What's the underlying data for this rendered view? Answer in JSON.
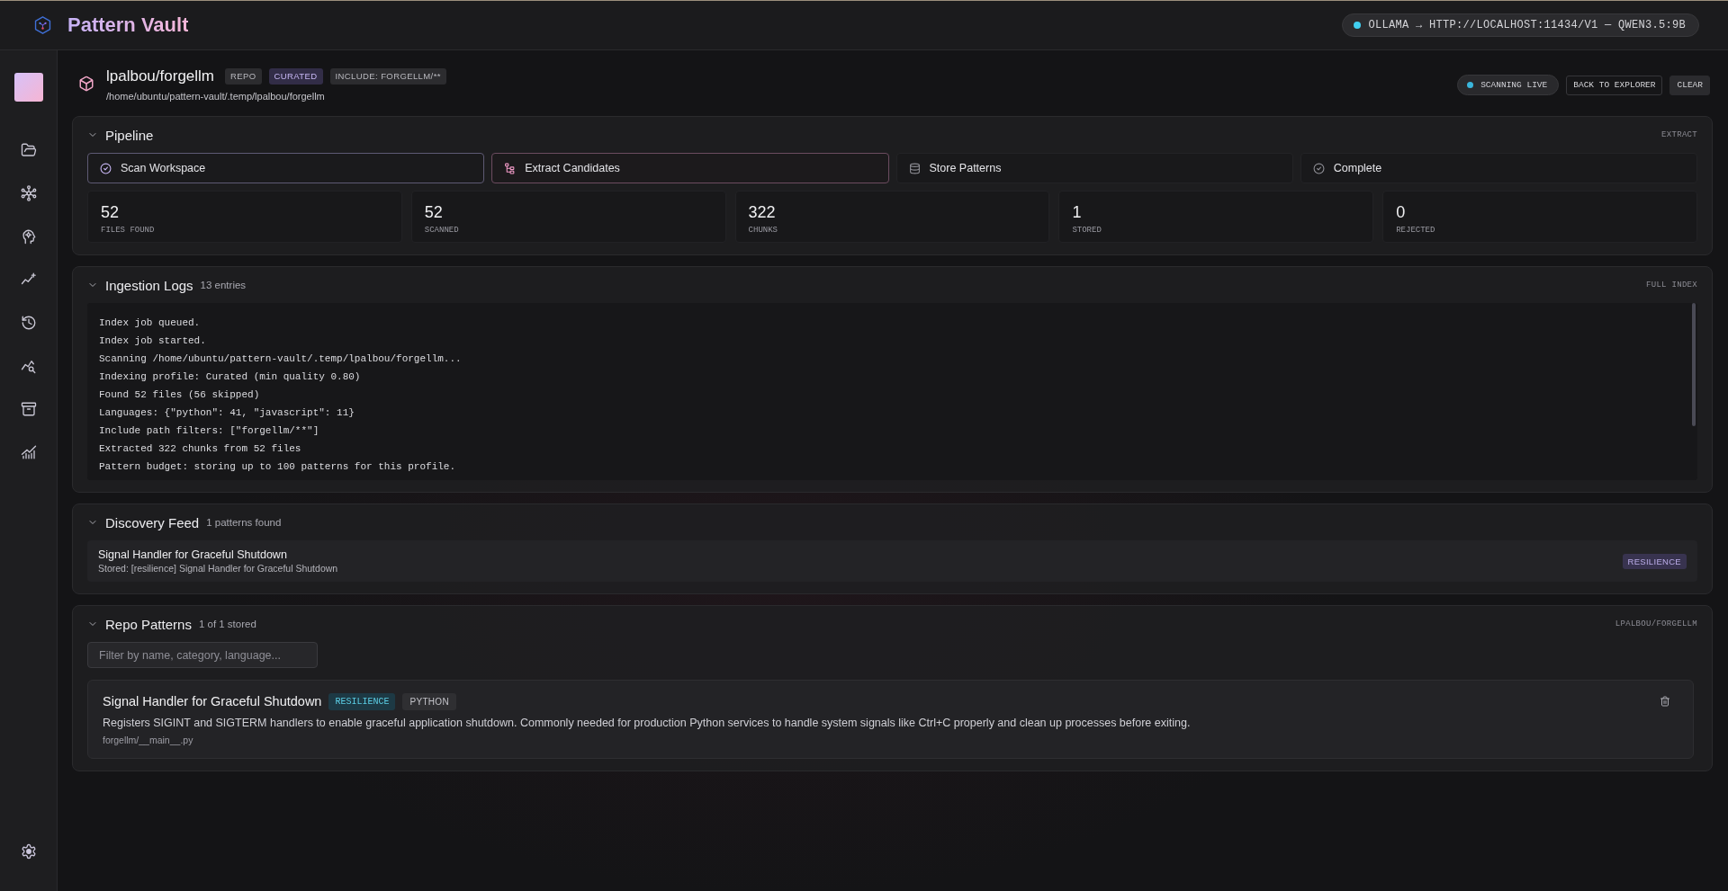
{
  "app": {
    "title": "Pattern Vault",
    "endpoint": {
      "label": "OLLAMA → HTTP://LOCALHOST:11434/V1 — QWEN3.5:9B",
      "connected": true
    }
  },
  "repo": {
    "name": "lpalbou/forgellm",
    "badges": [
      {
        "label": "REPO",
        "kind": "neutral"
      },
      {
        "label": "CURATED",
        "kind": "accent"
      },
      {
        "label": "INCLUDE: FORGELLM/**",
        "kind": "neutral"
      }
    ],
    "path": "/home/ubuntu/pattern-vault/.temp/lpalbou/forgellm",
    "scan_status": {
      "label": "SCANNING LIVE",
      "live": true
    },
    "actions": [
      {
        "label": "BACK TO EXPLORER",
        "kind": "outline"
      },
      {
        "label": "CLEAR",
        "kind": "filled"
      }
    ]
  },
  "pipeline": {
    "title": "Pipeline",
    "expanded": true,
    "stage": "EXTRACT",
    "steps": [
      {
        "label": "Scan Workspace",
        "completed": true,
        "current": false
      },
      {
        "label": "Extract Candidates",
        "completed": false,
        "current": true
      },
      {
        "label": "Store Patterns",
        "completed": false,
        "current": false
      },
      {
        "label": "Complete",
        "completed": false,
        "current": false
      }
    ],
    "stats": [
      {
        "value": "52",
        "label": "FILES FOUND"
      },
      {
        "value": "52",
        "label": "SCANNED"
      },
      {
        "value": "322",
        "label": "CHUNKS"
      },
      {
        "value": "1",
        "label": "STORED"
      },
      {
        "value": "0",
        "label": "REJECTED"
      }
    ]
  },
  "ingestion_logs": {
    "title": "Ingestion Logs",
    "count": "13 entries",
    "expanded": true,
    "mode": "FULL INDEX",
    "lines": [
      "Index job queued.",
      "Index job started.",
      "Scanning /home/ubuntu/pattern-vault/.temp/lpalbou/forgellm...",
      "Indexing profile: Curated (min quality 0.80)",
      "Found 52 files (56 skipped)",
      "Languages: {\"python\": 41, \"javascript\": 11}",
      "Include path filters: [\"forgellm/**\"]",
      "Extracted 322 chunks from 52 files",
      "Pattern budget: storing up to 100 patterns for this profile."
    ]
  },
  "discovery_feed": {
    "title": "Discovery Feed",
    "count": "1 patterns found",
    "expanded": true,
    "items": [
      {
        "title": "Signal Handler for Graceful Shutdown",
        "detail": "Stored: [resilience] Signal Handler for Graceful Shutdown",
        "tag": "RESILIENCE"
      }
    ]
  },
  "repo_patterns": {
    "title": "Repo Patterns",
    "count": "1 of 1 stored",
    "expanded": true,
    "scope": "LPALBOU/FORGELLM",
    "filter": {
      "placeholder": "Filter by name, category, language..."
    },
    "patterns": [
      {
        "name": "Signal Handler for Graceful Shutdown",
        "category": "RESILIENCE",
        "language": "PYTHON",
        "description": "Registers SIGINT and SIGTERM handlers to enable graceful application shutdown. Commonly needed for production Python services to handle system signals like Ctrl+C properly and clean up processes before exiting.",
        "file": "forgellm/__main__.py"
      }
    ]
  }
}
